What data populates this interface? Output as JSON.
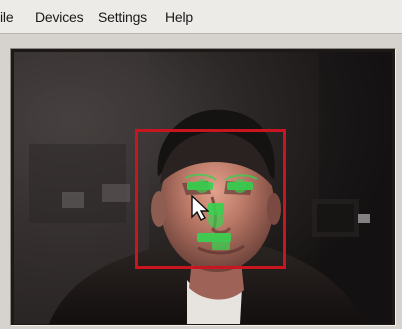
{
  "menu": {
    "items": [
      "File",
      "Devices",
      "Settings",
      "Help"
    ],
    "visible_text": [
      "ile",
      "Devices",
      "Settings",
      "Help"
    ]
  },
  "video": {
    "overlay_color": "#c8151f",
    "feature_color": "#36d34f"
  },
  "icons": {
    "cursor": "mouse-pointer-icon"
  }
}
